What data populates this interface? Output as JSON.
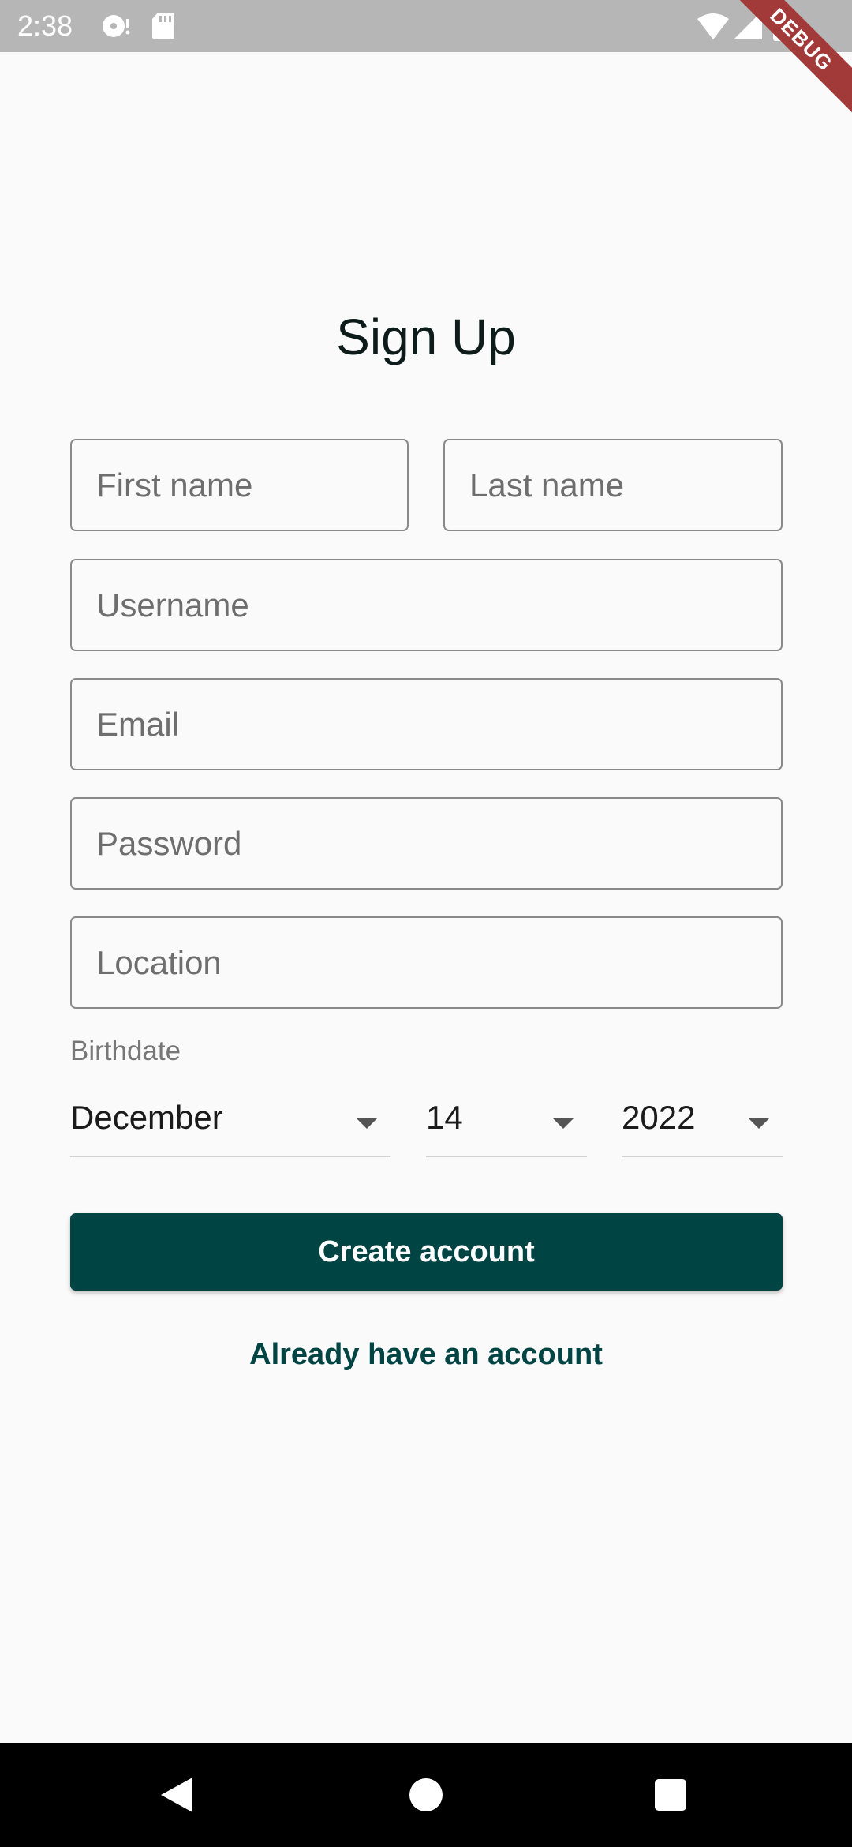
{
  "status_bar": {
    "time": "2:38"
  },
  "debug_banner": "DEBUG",
  "title": "Sign Up",
  "fields": {
    "first_name": "First name",
    "last_name": "Last name",
    "username": "Username",
    "email": "Email",
    "password": "Password",
    "location": "Location"
  },
  "birthdate": {
    "label": "Birthdate",
    "month": "December",
    "day": "14",
    "year": "2022"
  },
  "actions": {
    "create_account": "Create account",
    "already_have_account": "Already have an account"
  },
  "colors": {
    "primary": "#004443",
    "background": "#fafafa",
    "status_bar": "#b6b6b6",
    "debug_ribbon": "#a33a3a"
  }
}
